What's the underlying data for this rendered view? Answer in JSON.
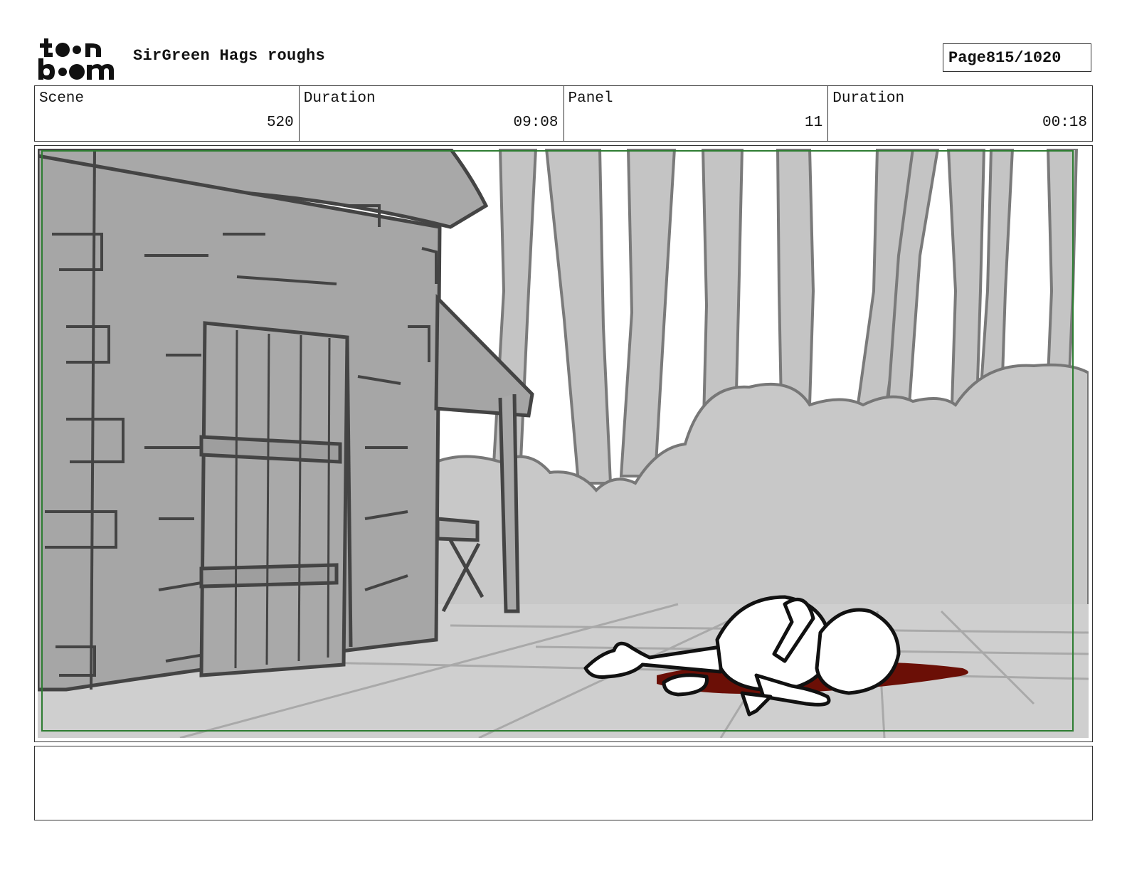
{
  "header": {
    "logo_text": "toon boom",
    "project_title": "SirGreen Hags roughs",
    "page_label": "Page",
    "page_value": "815/1020"
  },
  "info": {
    "scene_label": "Scene",
    "scene_value": "520",
    "scene_duration_label": "Duration",
    "scene_duration_value": "09:08",
    "panel_label": "Panel",
    "panel_value": "11",
    "panel_duration_label": "Duration",
    "panel_duration_value": "00:18"
  },
  "notes": {
    "text": ""
  },
  "colors": {
    "safe_frame": "#2e7d32",
    "blood": "#6b0f06",
    "ink": "#444444"
  }
}
